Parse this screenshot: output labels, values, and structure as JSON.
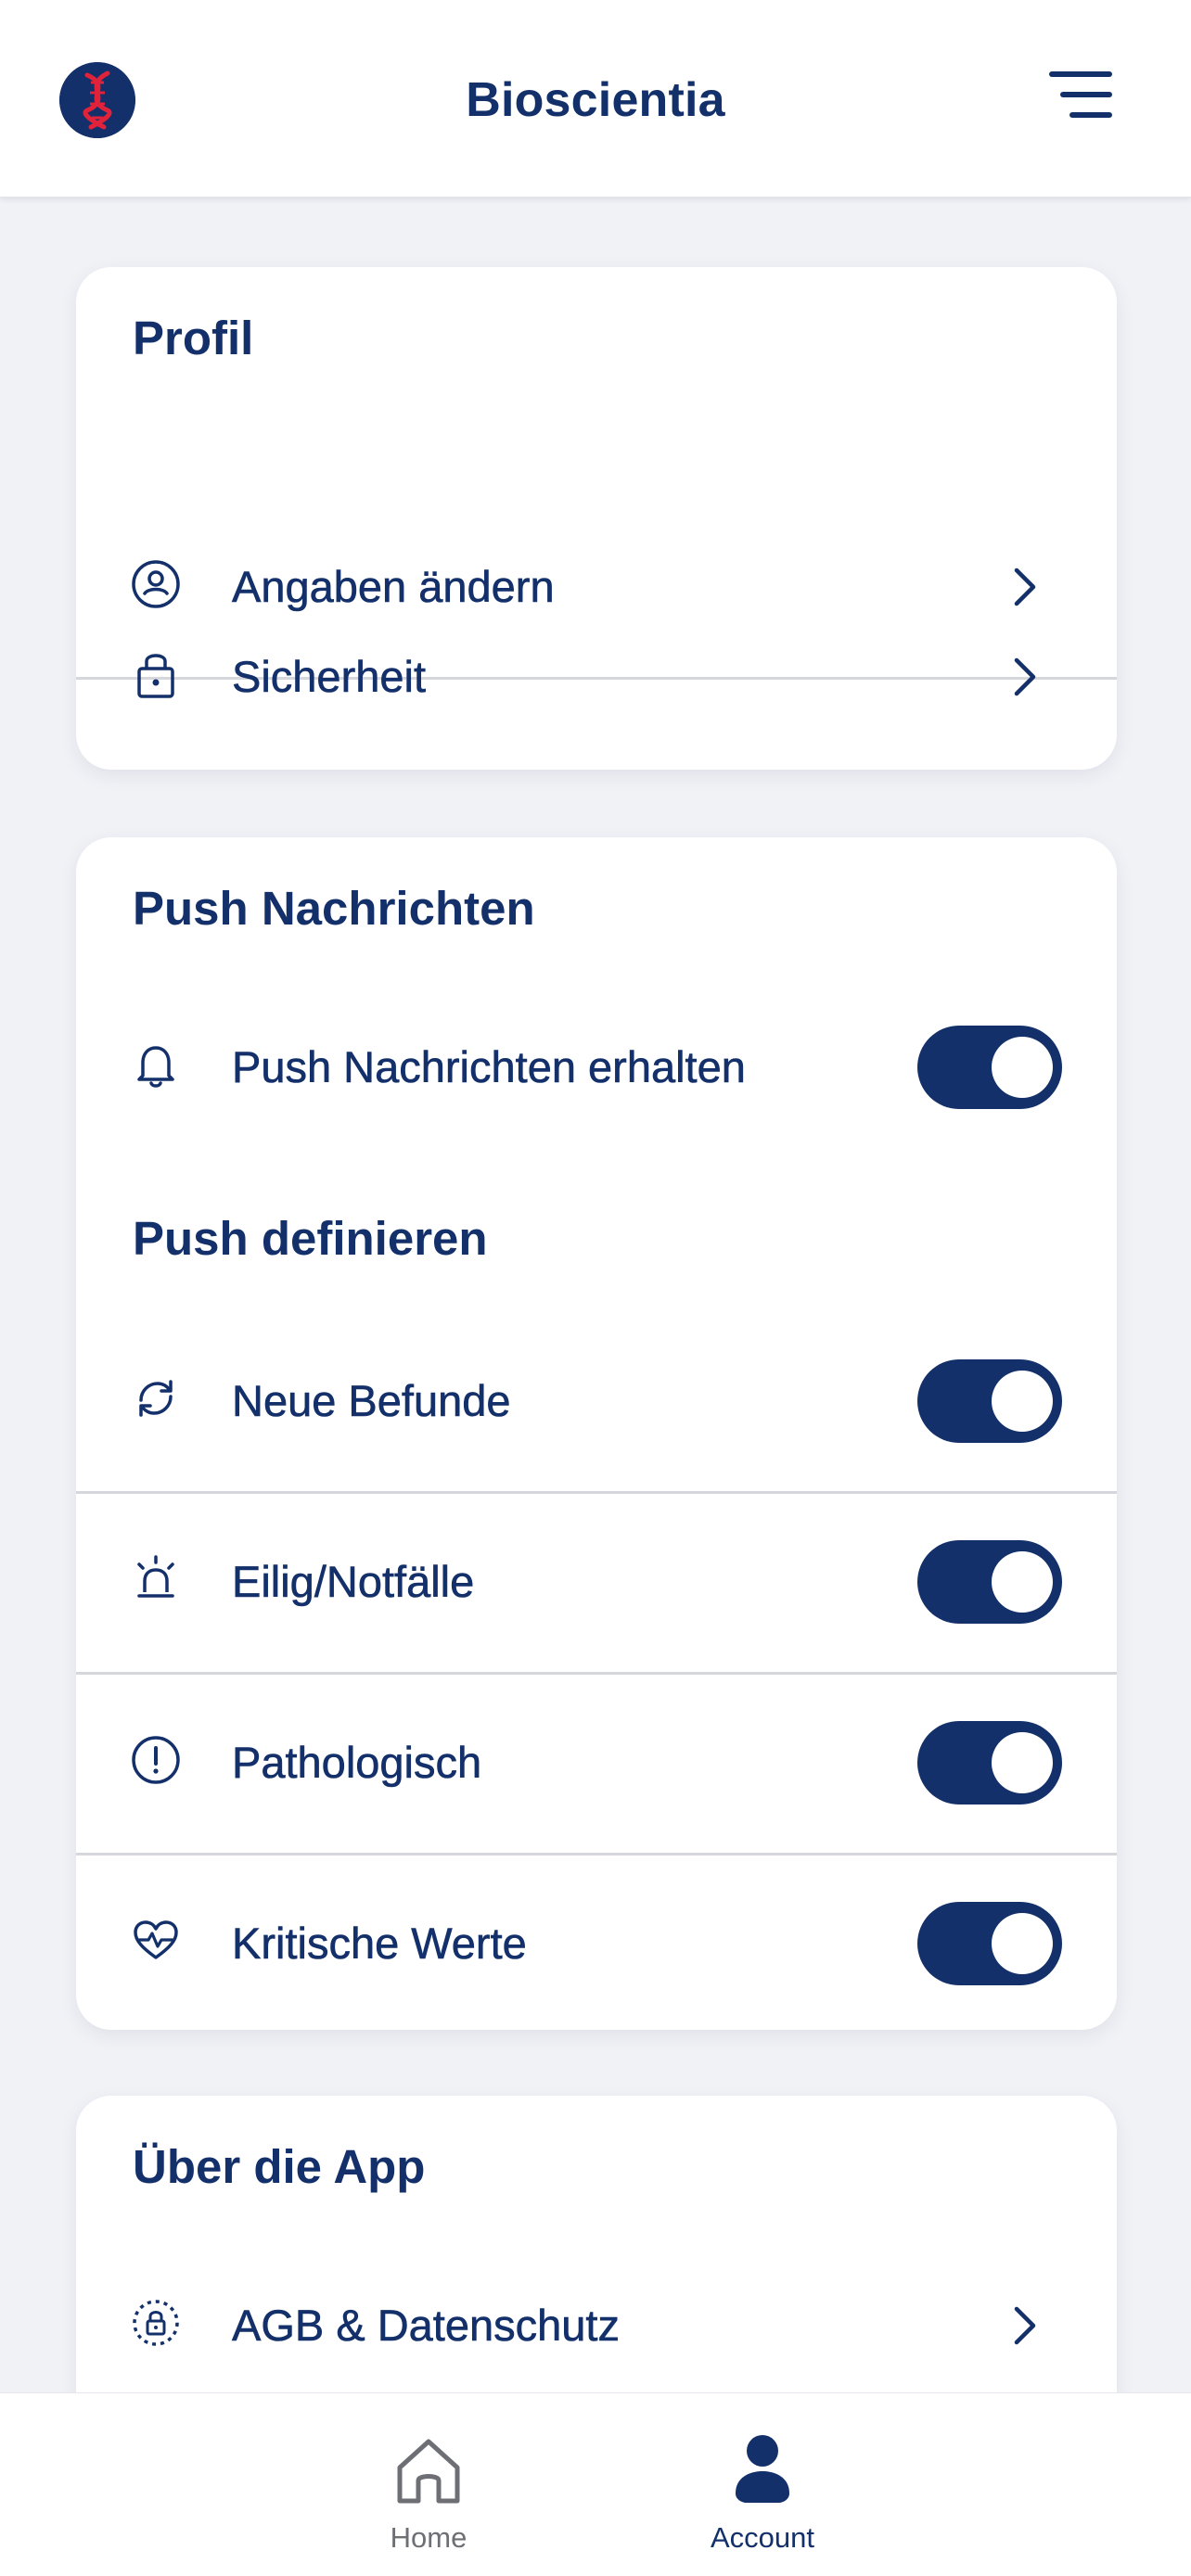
{
  "header": {
    "title": "Bioscientia",
    "logo_icon": "dna-logo-icon",
    "menu_icon": "hamburger-menu-icon"
  },
  "profil": {
    "title": "Profil",
    "items": [
      {
        "label": "Angaben ändern",
        "icon": "user-circle-icon"
      },
      {
        "label": "Sicherheit",
        "icon": "lock-icon"
      }
    ]
  },
  "push": {
    "title": "Push Nachrichten",
    "receive": {
      "label": "Push Nachrichten erhalten",
      "icon": "bell-icon",
      "enabled": true
    },
    "define_title": "Push definieren",
    "items": [
      {
        "label": "Neue Befunde",
        "icon": "refresh-icon",
        "enabled": true
      },
      {
        "label": "Eilig/Notfälle",
        "icon": "alarm-light-icon",
        "enabled": true
      },
      {
        "label": "Pathologisch",
        "icon": "exclamation-circle-icon",
        "enabled": true
      },
      {
        "label": "Kritische Werte",
        "icon": "heart-pulse-icon",
        "enabled": true
      }
    ]
  },
  "about": {
    "title": "Über die App",
    "items": [
      {
        "label": "AGB & Datenschutz",
        "icon": "shield-lock-icon"
      }
    ]
  },
  "bottom_nav": {
    "items": [
      {
        "label": "Home",
        "icon": "home-icon",
        "active": false
      },
      {
        "label": "Account",
        "icon": "user-icon",
        "active": true
      }
    ]
  },
  "colors": {
    "primary": "#14306a",
    "accent_red": "#e0233a",
    "background": "#f1f2f6",
    "card": "#ffffff",
    "inactive": "#6d6f75"
  }
}
